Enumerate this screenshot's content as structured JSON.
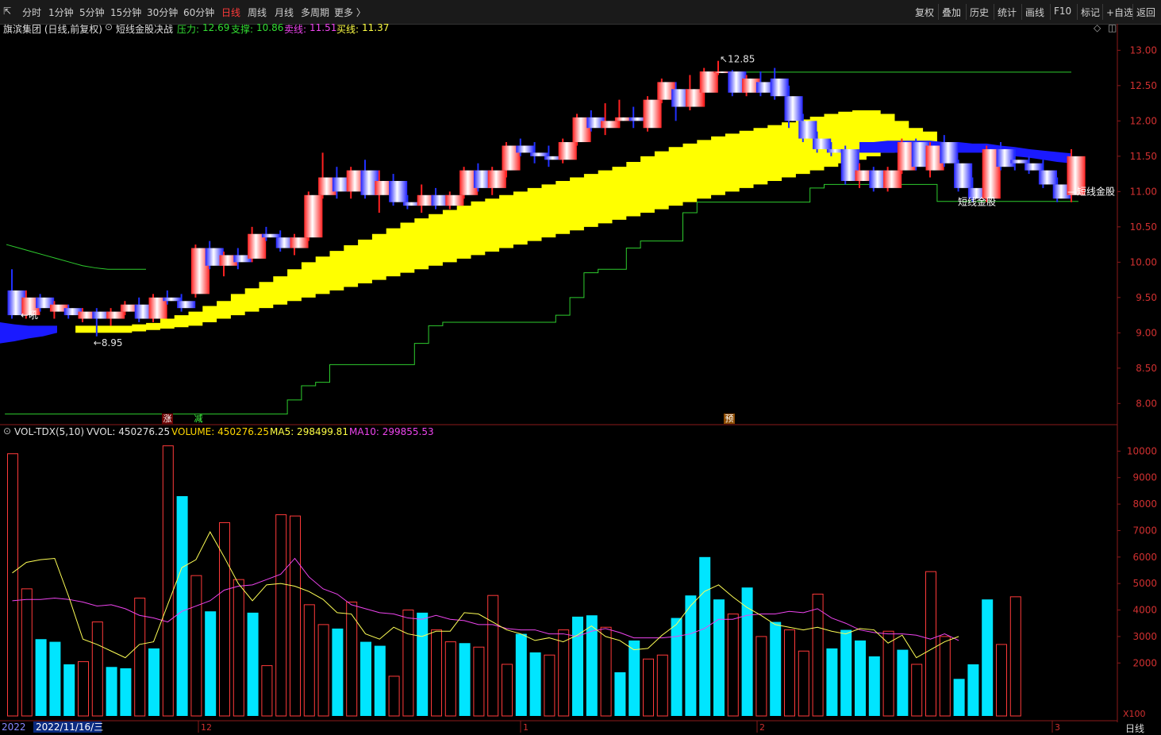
{
  "toolbar": {
    "left": [
      "分时",
      "1分钟",
      "5分钟",
      "15分钟",
      "30分钟",
      "60分钟",
      "日线",
      "周线",
      "月线",
      "多周期",
      "更多 〉"
    ],
    "active": "日线",
    "right": [
      "复权",
      "叠加",
      "历史",
      "统计",
      "画线",
      "F10",
      "标记",
      "+自选",
      "返回"
    ]
  },
  "main_legend": {
    "stock": "旗滨集团 (日线,前复权)",
    "indicator": "短线金股决战",
    "pressure_label": "压力:",
    "pressure_value": "12.69",
    "support_label": "支撑:",
    "support_value": "10.86",
    "sell_label": "卖线:",
    "sell_value": "11.51",
    "buy_label": "买线:",
    "buy_value": "11.37"
  },
  "vol_legend": {
    "name": "VOL-TDX(5,10)",
    "vvol": "VVOL: 450276.25",
    "volume": "VOLUME: 450276.25",
    "ma5": "MA5: 298499.81",
    "ma10": "MA10: 299855.53"
  },
  "annotations": {
    "high": "12.85",
    "low": "8.95",
    "label_right": "短线金股",
    "label_mid": "短线金股",
    "label_left": "吼",
    "marker_zhang": "涨",
    "marker_jian": "减",
    "marker_yu": "预"
  },
  "x_axis": {
    "year": "2022",
    "date_box": "2022/11/16/三",
    "month_ticks": [
      "12",
      "1",
      "2",
      "3"
    ]
  },
  "bottom_tag": "日线",
  "vol_unit": "X100",
  "colors": {
    "up": "#ff3a3a",
    "down": "#00e5ff",
    "yellow_band": "#ffff00",
    "blue_band": "#1a1aff",
    "support_line": "#2ecc2e",
    "ma5": "#ffff55",
    "ma10": "#ee44ee"
  },
  "chart_data": [
    {
      "type": "candlestick",
      "title": "旗滨集团 (日线,前复权)",
      "y_ticks": [
        8.0,
        8.5,
        9.0,
        9.5,
        10.0,
        10.5,
        11.0,
        11.5,
        12.0,
        12.5,
        13.0
      ],
      "ylim": [
        7.7,
        13.15
      ],
      "ohlc": [
        [
          9.6,
          9.9,
          9.2,
          9.25
        ],
        [
          9.25,
          9.6,
          9.2,
          9.5
        ],
        [
          9.5,
          9.55,
          9.3,
          9.35
        ],
        [
          9.3,
          9.45,
          9.2,
          9.4
        ],
        [
          9.35,
          9.4,
          9.2,
          9.25
        ],
        [
          9.2,
          9.35,
          9.15,
          9.3
        ],
        [
          9.3,
          9.35,
          8.95,
          9.2
        ],
        [
          9.2,
          9.35,
          9.1,
          9.3
        ],
        [
          9.3,
          9.45,
          9.25,
          9.4
        ],
        [
          9.4,
          9.5,
          9.15,
          9.2
        ],
        [
          9.2,
          9.55,
          9.15,
          9.5
        ],
        [
          9.5,
          9.6,
          9.4,
          9.45
        ],
        [
          9.45,
          9.55,
          9.3,
          9.35
        ],
        [
          9.55,
          10.25,
          9.5,
          10.2
        ],
        [
          10.2,
          10.3,
          9.9,
          9.95
        ],
        [
          9.95,
          10.15,
          9.8,
          10.1
        ],
        [
          10.1,
          10.2,
          9.9,
          10.0
        ],
        [
          10.05,
          10.5,
          10.0,
          10.4
        ],
        [
          10.4,
          10.5,
          10.3,
          10.35
        ],
        [
          10.35,
          10.45,
          10.15,
          10.2
        ],
        [
          10.2,
          10.4,
          10.1,
          10.35
        ],
        [
          10.35,
          11.0,
          10.3,
          10.95
        ],
        [
          10.95,
          11.55,
          10.9,
          11.2
        ],
        [
          11.2,
          11.35,
          10.9,
          11.0
        ],
        [
          11.0,
          11.35,
          10.9,
          11.3
        ],
        [
          11.3,
          11.45,
          10.9,
          10.95
        ],
        [
          10.95,
          11.3,
          10.7,
          11.15
        ],
        [
          11.15,
          11.25,
          10.8,
          10.85
        ],
        [
          10.85,
          10.95,
          10.75,
          10.8
        ],
        [
          10.8,
          11.1,
          10.7,
          10.95
        ],
        [
          10.95,
          11.05,
          10.75,
          10.8
        ],
        [
          10.8,
          11.0,
          10.75,
          10.95
        ],
        [
          10.95,
          11.35,
          10.9,
          11.3
        ],
        [
          11.3,
          11.4,
          11.0,
          11.05
        ],
        [
          11.05,
          11.35,
          10.95,
          11.3
        ],
        [
          11.3,
          11.7,
          11.2,
          11.65
        ],
        [
          11.65,
          11.75,
          11.5,
          11.55
        ],
        [
          11.55,
          11.7,
          11.4,
          11.5
        ],
        [
          11.5,
          11.65,
          11.35,
          11.45
        ],
        [
          11.45,
          11.75,
          11.4,
          11.7
        ],
        [
          11.7,
          12.1,
          11.65,
          12.05
        ],
        [
          12.05,
          12.15,
          11.85,
          11.9
        ],
        [
          11.9,
          12.25,
          11.8,
          12.0
        ],
        [
          12.0,
          12.3,
          11.9,
          12.05
        ],
        [
          12.05,
          12.2,
          11.9,
          12.0
        ],
        [
          11.9,
          12.35,
          11.85,
          12.3
        ],
        [
          12.3,
          12.6,
          12.25,
          12.55
        ],
        [
          12.45,
          12.55,
          12.0,
          12.2
        ],
        [
          12.2,
          12.65,
          12.15,
          12.45
        ],
        [
          12.4,
          12.75,
          12.2,
          12.7
        ],
        [
          12.7,
          12.85,
          12.65,
          12.7
        ],
        [
          12.7,
          12.72,
          12.35,
          12.4
        ],
        [
          12.4,
          12.65,
          12.35,
          12.6
        ],
        [
          12.55,
          12.7,
          12.35,
          12.4
        ],
        [
          12.6,
          12.75,
          12.3,
          12.35
        ],
        [
          12.35,
          12.5,
          11.9,
          12.0
        ],
        [
          12.0,
          12.1,
          11.7,
          11.75
        ],
        [
          11.75,
          11.85,
          11.55,
          11.6
        ],
        [
          11.6,
          11.7,
          11.5,
          11.55
        ],
        [
          11.6,
          11.65,
          11.1,
          11.15
        ],
        [
          11.15,
          11.4,
          11.05,
          11.3
        ],
        [
          11.3,
          11.35,
          11.0,
          11.05
        ],
        [
          11.05,
          11.35,
          11.0,
          11.3
        ],
        [
          11.3,
          11.75,
          11.25,
          11.7
        ],
        [
          11.7,
          11.75,
          11.3,
          11.35
        ],
        [
          11.3,
          11.7,
          11.2,
          11.65
        ],
        [
          11.7,
          11.8,
          11.35,
          11.4
        ],
        [
          11.4,
          11.45,
          11.0,
          11.05
        ],
        [
          11.05,
          11.2,
          10.85,
          10.9
        ],
        [
          10.9,
          11.65,
          10.85,
          11.6
        ],
        [
          11.6,
          11.7,
          11.3,
          11.35
        ],
        [
          11.45,
          11.6,
          11.3,
          11.4
        ],
        [
          11.4,
          11.5,
          11.25,
          11.3
        ],
        [
          11.3,
          11.45,
          11.05,
          11.1
        ],
        [
          11.1,
          11.2,
          10.85,
          10.9
        ],
        [
          10.95,
          11.6,
          10.85,
          11.5
        ]
      ],
      "yellow_band": [
        [
          9.0,
          9.1
        ],
        [
          9.0,
          9.1
        ],
        [
          9.0,
          9.1
        ],
        [
          9.0,
          9.1
        ],
        [
          9.02,
          9.12
        ],
        [
          9.04,
          9.14
        ],
        [
          9.06,
          9.2
        ],
        [
          9.08,
          9.25
        ],
        [
          9.1,
          9.3
        ],
        [
          9.15,
          9.38
        ],
        [
          9.2,
          9.45
        ],
        [
          9.25,
          9.55
        ],
        [
          9.3,
          9.63
        ],
        [
          9.35,
          9.72
        ],
        [
          9.4,
          9.8
        ],
        [
          9.45,
          9.9
        ],
        [
          9.5,
          10.0
        ],
        [
          9.55,
          10.08
        ],
        [
          9.6,
          10.16
        ],
        [
          9.65,
          10.24
        ],
        [
          9.7,
          10.32
        ],
        [
          9.75,
          10.4
        ],
        [
          9.8,
          10.48
        ],
        [
          9.85,
          10.56
        ],
        [
          9.9,
          10.62
        ],
        [
          9.95,
          10.68
        ],
        [
          10.0,
          10.74
        ],
        [
          10.05,
          10.8
        ],
        [
          10.1,
          10.86
        ],
        [
          10.15,
          10.9
        ],
        [
          10.2,
          10.95
        ],
        [
          10.25,
          11.0
        ],
        [
          10.3,
          11.05
        ],
        [
          10.35,
          11.1
        ],
        [
          10.4,
          11.15
        ],
        [
          10.45,
          11.2
        ],
        [
          10.5,
          11.25
        ],
        [
          10.55,
          11.3
        ],
        [
          10.6,
          11.35
        ],
        [
          10.65,
          11.42
        ],
        [
          10.7,
          11.5
        ],
        [
          10.75,
          11.57
        ],
        [
          10.8,
          11.63
        ],
        [
          10.85,
          11.68
        ],
        [
          10.9,
          11.73
        ],
        [
          10.95,
          11.78
        ],
        [
          11.0,
          11.82
        ],
        [
          11.05,
          11.86
        ],
        [
          11.1,
          11.9
        ],
        [
          11.15,
          11.94
        ],
        [
          11.2,
          11.98
        ],
        [
          11.25,
          12.02
        ],
        [
          11.3,
          12.06
        ],
        [
          11.35,
          12.1
        ],
        [
          11.4,
          12.13
        ],
        [
          11.45,
          12.15
        ],
        [
          11.5,
          12.15
        ],
        [
          11.55,
          12.1
        ],
        [
          11.6,
          12.0
        ],
        [
          11.65,
          11.9
        ],
        [
          11.7,
          11.85
        ]
      ],
      "blue_band_right": [
        [
          11.55,
          11.7
        ],
        [
          11.55,
          11.7
        ],
        [
          11.55,
          11.72
        ],
        [
          11.55,
          11.72
        ],
        [
          11.55,
          11.72
        ],
        [
          11.55,
          11.72
        ],
        [
          11.55,
          11.7
        ],
        [
          11.55,
          11.7
        ],
        [
          11.55,
          11.68
        ],
        [
          11.55,
          11.68
        ],
        [
          11.52,
          11.65
        ],
        [
          11.5,
          11.63
        ],
        [
          11.48,
          11.6
        ],
        [
          11.45,
          11.58
        ],
        [
          11.42,
          11.56
        ],
        [
          11.4,
          11.54
        ]
      ],
      "blue_band_left": [
        [
          8.85,
          9.15
        ],
        [
          8.88,
          9.12
        ],
        [
          8.92,
          9.1
        ],
        [
          8.95,
          9.1
        ],
        [
          9.0,
          9.1
        ]
      ],
      "support_step": [
        7.85,
        7.85,
        7.85,
        7.85,
        7.85,
        7.85,
        7.85,
        7.85,
        7.85,
        7.85,
        7.85,
        7.85,
        7.85,
        7.85,
        7.85,
        7.85,
        7.85,
        7.85,
        7.85,
        7.85,
        8.05,
        8.25,
        8.3,
        8.55,
        8.55,
        8.55,
        8.55,
        8.55,
        8.55,
        8.85,
        9.1,
        9.15,
        9.15,
        9.15,
        9.15,
        9.15,
        9.15,
        9.15,
        9.15,
        9.25,
        9.5,
        9.85,
        9.9,
        9.9,
        10.2,
        10.3,
        10.3,
        10.3,
        10.7,
        10.85,
        10.85,
        10.85,
        10.85,
        10.85,
        10.85,
        10.85,
        10.85,
        11.05,
        11.1,
        11.1,
        11.1,
        11.1,
        11.1,
        11.1,
        11.1,
        11.1,
        10.86,
        10.86,
        10.86,
        10.86,
        10.86,
        10.86,
        10.86,
        10.86,
        10.86,
        10.86
      ],
      "envelope_upper": [
        10.25,
        10.2,
        10.15,
        10.1,
        10.05,
        10.0,
        9.95,
        9.92,
        9.9,
        9.9,
        9.9,
        9.9
      ],
      "pressure_line": {
        "from_index": 50,
        "to_index": 75,
        "value": 12.69
      }
    },
    {
      "type": "bar",
      "title": "VOL-TDX(5,10)",
      "y_ticks": [
        2000,
        3000,
        4000,
        5000,
        6000,
        7000,
        8000,
        9000,
        10000
      ],
      "ylim": [
        0,
        10400
      ],
      "values": [
        9900,
        4800,
        2900,
        2800,
        1950,
        2050,
        3550,
        1850,
        1800,
        4450,
        2550,
        10200,
        8300,
        5300,
        3950,
        7300,
        5150,
        3900,
        1900,
        7600,
        7550,
        4200,
        3450,
        3300,
        4300,
        2800,
        2650,
        1500,
        4000,
        3900,
        3250,
        2800,
        2750,
        2600,
        4550,
        1950,
        3100,
        2400,
        2300,
        3250,
        3750,
        3800,
        3350,
        1650,
        2850,
        2150,
        2300,
        3700,
        4550,
        6000,
        4400,
        3850,
        4850,
        3000,
        3550,
        3250,
        2450,
        4600,
        2550,
        3250,
        2850,
        2250,
        3200,
        2500,
        1950,
        5450,
        3000,
        1400,
        1950,
        4400,
        2700,
        4500
      ],
      "direction": [
        "up",
        "up",
        "down",
        "down",
        "down",
        "up",
        "up",
        "down",
        "down",
        "up",
        "down",
        "up",
        "down",
        "up",
        "down",
        "up",
        "up",
        "down",
        "up",
        "up",
        "up",
        "up",
        "up",
        "down",
        "up",
        "down",
        "down",
        "up",
        "up",
        "down",
        "up",
        "up",
        "down",
        "up",
        "up",
        "up",
        "down",
        "down",
        "up",
        "up",
        "down",
        "down",
        "up",
        "down",
        "down",
        "up",
        "up",
        "down",
        "down",
        "down",
        "down",
        "up",
        "down",
        "up",
        "down",
        "up",
        "up",
        "up",
        "down",
        "down",
        "down",
        "down",
        "up",
        "down",
        "up",
        "up",
        "up",
        "down",
        "down",
        "down",
        "up",
        "up"
      ],
      "ma5": [
        5400,
        5800,
        5900,
        5950,
        4500,
        2900,
        2700,
        2450,
        2200,
        2700,
        2800,
        4200,
        5600,
        5900,
        6950,
        6000,
        5000,
        4350,
        4950,
        5000,
        4900,
        4700,
        4400,
        3900,
        3850,
        3100,
        2900,
        3350,
        3100,
        3000,
        3200,
        3200,
        3900,
        3850,
        3550,
        3250,
        3100,
        2850,
        2950,
        2800,
        3050,
        3400,
        3000,
        2850,
        2500,
        2550,
        3050,
        3450,
        4150,
        4700,
        4950,
        4500,
        4100,
        3800,
        3450,
        3350,
        3250,
        3350,
        3200,
        3100,
        3300,
        3250,
        2750,
        3050,
        2200,
        2500,
        2800,
        3000
      ],
      "ma10": [
        4350,
        4400,
        4400,
        4450,
        4400,
        4300,
        4150,
        4200,
        4050,
        3800,
        3700,
        3550,
        3950,
        4150,
        4350,
        4750,
        4900,
        4950,
        5150,
        5350,
        5950,
        5250,
        4800,
        4600,
        4200,
        4050,
        3900,
        3850,
        3700,
        3650,
        3800,
        3650,
        3600,
        3450,
        3450,
        3300,
        3250,
        3250,
        3100,
        3100,
        3000,
        3200,
        3300,
        3150,
        2950,
        2950,
        2950,
        3000,
        3100,
        3300,
        3650,
        3650,
        3800,
        3850,
        3850,
        3950,
        3900,
        4050,
        3700,
        3500,
        3250,
        3150,
        3100,
        3100,
        3050,
        2900,
        3100,
        2850
      ]
    }
  ]
}
